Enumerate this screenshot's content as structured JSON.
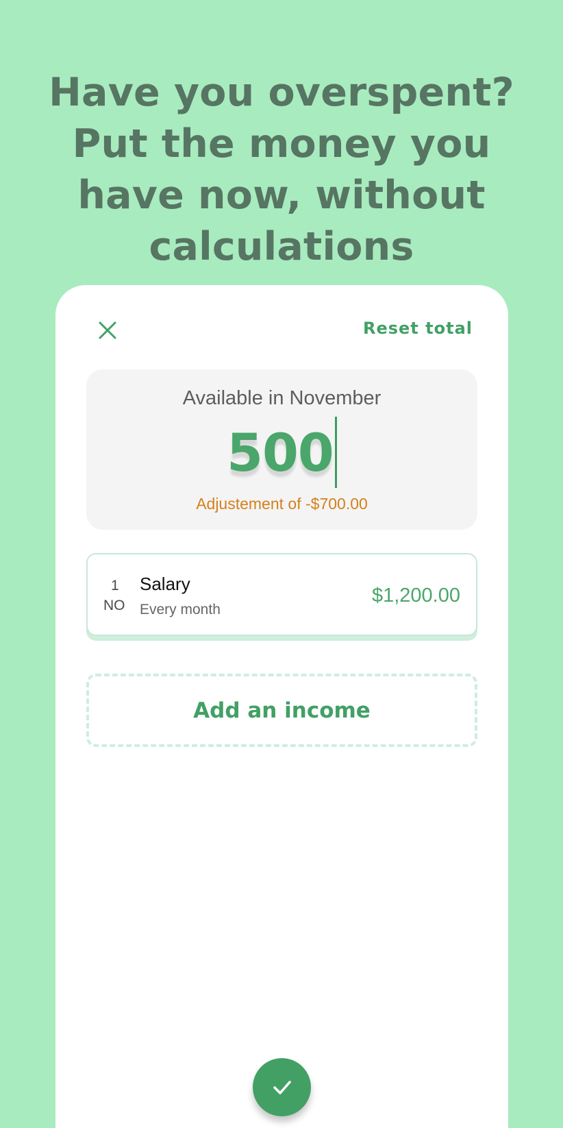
{
  "headline": "Have you overspent? Put the money you have now, without calculations",
  "header": {
    "close_icon": "close-icon",
    "reset_label": "Reset total"
  },
  "balance": {
    "title": "Available in November",
    "amount_value": "500",
    "adjustment_text": "Adjustement of -$700.00"
  },
  "incomes": [
    {
      "day": "1",
      "month": "NO",
      "name": "Salary",
      "frequency": "Every month",
      "amount": "$1,200.00"
    }
  ],
  "add_income_label": "Add an income",
  "confirm_icon": "check-icon",
  "colors": {
    "background": "#a8ebbf",
    "headline": "#577563",
    "accent": "#42a065",
    "adjustment": "#d5801b",
    "card": "#ffffff",
    "panel": "#f4f4f4"
  }
}
